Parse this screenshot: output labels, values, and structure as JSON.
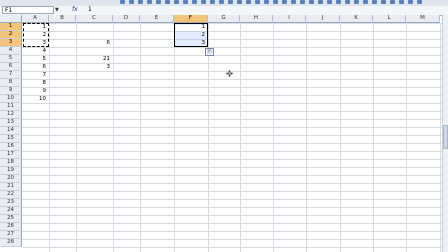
{
  "name_box": "F1",
  "formula_value": "1",
  "fx_label": "fx",
  "dropdown_glyph": "▼",
  "paste_icon_label": "Ⓟ",
  "columns": [
    "A",
    "B",
    "C",
    "D",
    "E",
    "F",
    "G",
    "H",
    "I",
    "J",
    "K",
    "L",
    "M"
  ],
  "rows": [
    "1",
    "2",
    "3",
    "4",
    "5",
    "6",
    "7",
    "8",
    "9",
    "10",
    "11",
    "12",
    "13",
    "14",
    "15",
    "16",
    "17",
    "18",
    "19",
    "20",
    "21",
    "22",
    "23",
    "24",
    "25",
    "26",
    "27",
    "28"
  ],
  "cells": {
    "A1": "1",
    "A2": "2",
    "A3": "3",
    "A4": "4",
    "A5": "5",
    "A6": "6",
    "A7": "7",
    "A8": "8",
    "A9": "9",
    "A10": "10",
    "C3": "6",
    "C5": "21",
    "C6": "3",
    "F1": "1",
    "F2": "2",
    "F3": "3"
  },
  "selected": {
    "column": "F",
    "rows": [
      "1",
      "2",
      "3"
    ]
  },
  "colors": {
    "header_selected": "#f6c37a",
    "selection": "#aac8ff",
    "grid": "#d6dce6"
  }
}
